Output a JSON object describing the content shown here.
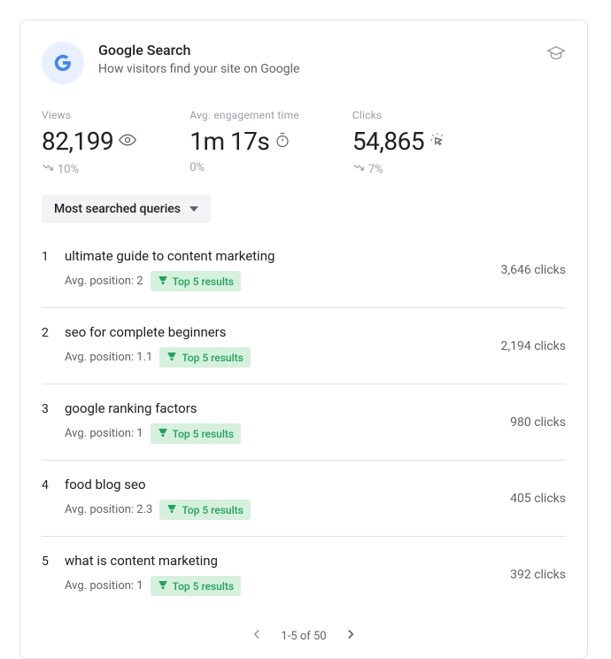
{
  "header": {
    "title": "Google Search",
    "subtitle": "How visitors find your site on Google"
  },
  "stats": {
    "views": {
      "label": "Views",
      "value": "82,199",
      "trend": "10%",
      "trend_dir": "down"
    },
    "engage": {
      "label": "Avg. engagement time",
      "value": "1m 17s",
      "trend": "0%",
      "trend_dir": "flat"
    },
    "clicks": {
      "label": "Clicks",
      "value": "54,865",
      "trend": "7%",
      "trend_dir": "down"
    }
  },
  "dropdown": {
    "label": "Most searched queries"
  },
  "pos_prefix": "Avg. position: ",
  "top5_label": "Top 5 results",
  "clicks_suffix": " clicks",
  "rows": [
    {
      "rank": "1",
      "query": "ultimate guide to content marketing",
      "pos": "2",
      "clicks": "3,646"
    },
    {
      "rank": "2",
      "query": "seo for complete beginners",
      "pos": "1.1",
      "clicks": "2,194"
    },
    {
      "rank": "3",
      "query": "google ranking factors",
      "pos": "1",
      "clicks": "980"
    },
    {
      "rank": "4",
      "query": "food blog seo",
      "pos": "2.3",
      "clicks": "405"
    },
    {
      "rank": "5",
      "query": "what is content marketing",
      "pos": "1",
      "clicks": "392"
    }
  ],
  "pager": {
    "text": "1-5 of 50"
  }
}
